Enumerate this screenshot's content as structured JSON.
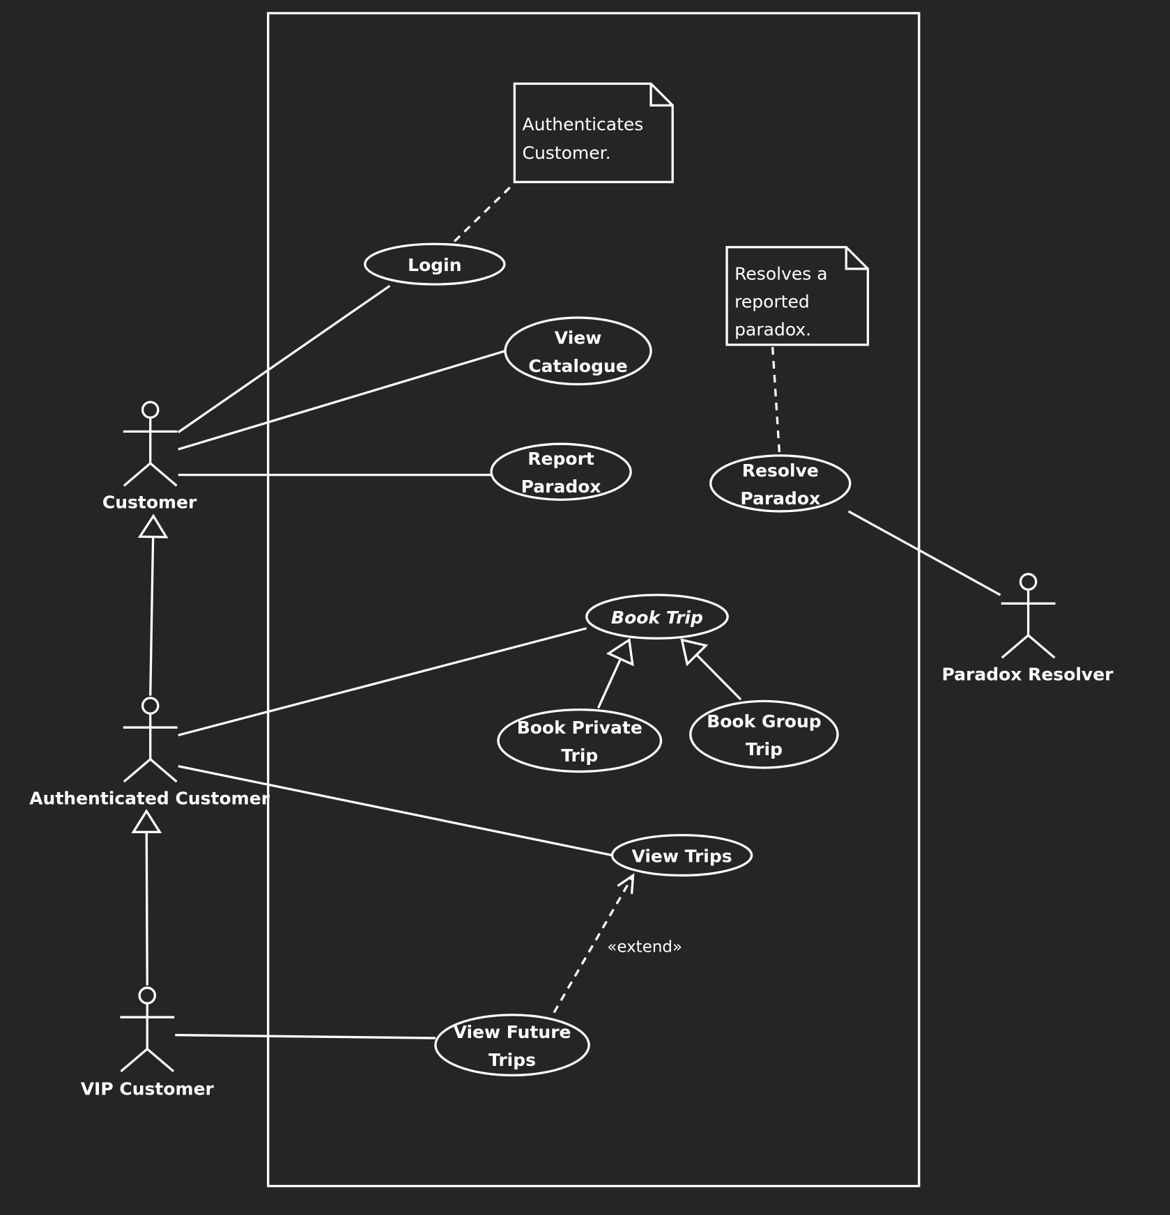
{
  "diagram": {
    "type": "UML use case diagram",
    "background_color": "#252525",
    "line_color": "#ffffff",
    "system_boundary": {
      "label": ""
    },
    "actors": [
      {
        "id": "customer",
        "label": "Customer"
      },
      {
        "id": "auth",
        "label": "Authenticated Customer"
      },
      {
        "id": "vip",
        "label": "VIP Customer"
      },
      {
        "id": "resolver",
        "label": "Paradox Resolver"
      }
    ],
    "use_cases": [
      {
        "id": "login",
        "lines": [
          "Login"
        ],
        "abstract": false
      },
      {
        "id": "catalogue",
        "lines": [
          "View",
          "Catalogue"
        ],
        "abstract": false
      },
      {
        "id": "report",
        "lines": [
          "Report",
          "Paradox"
        ],
        "abstract": false
      },
      {
        "id": "resolve",
        "lines": [
          "Resolve",
          "Paradox"
        ],
        "abstract": false
      },
      {
        "id": "booktrip",
        "lines": [
          "Book Trip"
        ],
        "abstract": true
      },
      {
        "id": "private",
        "lines": [
          "Book Private",
          "Trip"
        ],
        "abstract": false
      },
      {
        "id": "group",
        "lines": [
          "Book Group",
          "Trip"
        ],
        "abstract": false
      },
      {
        "id": "viewtrips",
        "lines": [
          "View Trips"
        ],
        "abstract": false
      },
      {
        "id": "future",
        "lines": [
          "View Future",
          "Trips"
        ],
        "abstract": false
      }
    ],
    "notes": [
      {
        "id": "note-login",
        "lines": [
          "Authenticates",
          "Customer."
        ],
        "attached_to": "login"
      },
      {
        "id": "note-resolve",
        "lines": [
          "Resolves a",
          "reported",
          "paradox."
        ],
        "attached_to": "resolve"
      }
    ],
    "associations": [
      {
        "from": "customer",
        "to": "login"
      },
      {
        "from": "customer",
        "to": "catalogue"
      },
      {
        "from": "customer",
        "to": "report"
      },
      {
        "from": "resolver",
        "to": "resolve"
      },
      {
        "from": "auth",
        "to": "booktrip"
      },
      {
        "from": "auth",
        "to": "viewtrips"
      },
      {
        "from": "vip",
        "to": "future"
      }
    ],
    "generalizations": [
      {
        "child": "auth",
        "parent": "customer"
      },
      {
        "child": "vip",
        "parent": "auth"
      },
      {
        "child": "private",
        "parent": "booktrip"
      },
      {
        "child": "group",
        "parent": "booktrip"
      }
    ],
    "extends": [
      {
        "from": "future",
        "to": "viewtrips",
        "label": "«extend»"
      }
    ]
  }
}
